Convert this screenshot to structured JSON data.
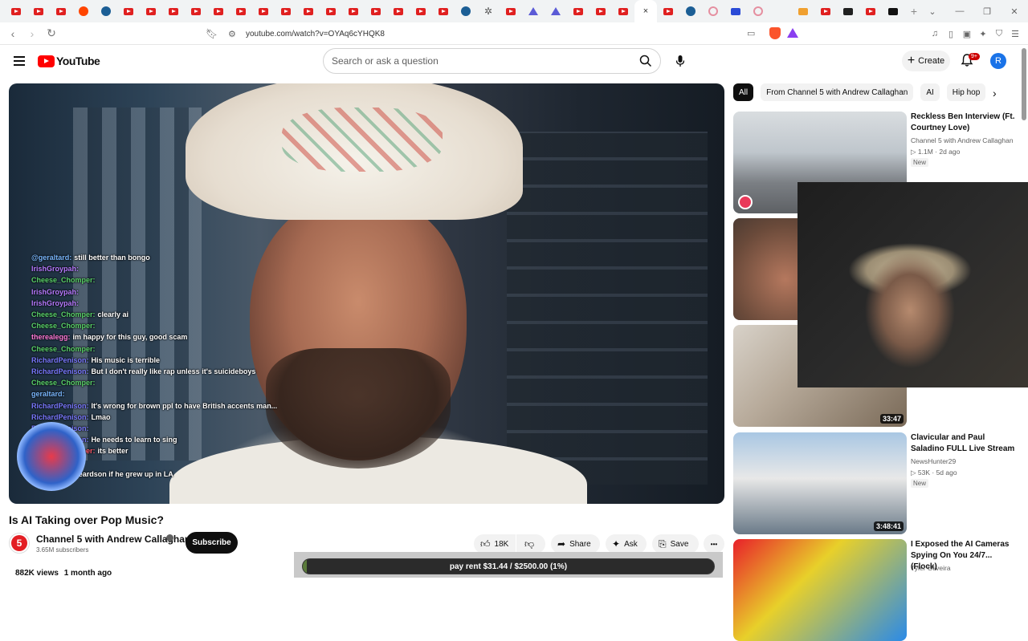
{
  "browser": {
    "active_tab_close": "×",
    "new_tab": "+",
    "url": "youtube.com/watch?v=OYAq6cYHQK8"
  },
  "header": {
    "logo_text": "YouTube",
    "search_placeholder": "Search or ask a question",
    "create_label": "Create",
    "notifications_badge": "9+",
    "avatar_letter": "R"
  },
  "player": {
    "chat": [
      {
        "user": "@geraltard:",
        "msg": "still better than bongo",
        "color": "#7ab8ff"
      },
      {
        "user": "IrishGroypah:",
        "msg": "",
        "color": "#b77bff"
      },
      {
        "user": "Cheese_Chomper:",
        "msg": "",
        "color": "#5ad16a"
      },
      {
        "user": "IrishGroypah:",
        "msg": "",
        "color": "#b77bff"
      },
      {
        "user": "IrishGroypah:",
        "msg": "",
        "color": "#b77bff"
      },
      {
        "user": "Cheese_Chomper:",
        "msg": "clearly ai",
        "color": "#5ad16a"
      },
      {
        "user": "Cheese_Chomper:",
        "msg": "",
        "color": "#5ad16a"
      },
      {
        "user": "therealegg:",
        "msg": "im happy for this guy, good scam",
        "color": "#ff7ad9"
      },
      {
        "user": "Cheese_Chomper:",
        "msg": "",
        "color": "#5ad16a"
      },
      {
        "user": "RichardPenison:",
        "msg": "His music is terrible",
        "color": "#7a7aff"
      },
      {
        "user": "RichardPenison:",
        "msg": "But I don't really like rap unless it's suicideboys",
        "color": "#7a7aff"
      },
      {
        "user": "Cheese_Chomper:",
        "msg": "",
        "color": "#5ad16a"
      },
      {
        "user": "geraltard:",
        "msg": "",
        "color": "#7ab8ff"
      },
      {
        "user": "RichardPenison:",
        "msg": "It's wrong for brown ppl to have British accents man...",
        "color": "#7a7aff"
      },
      {
        "user": "RichardPenison:",
        "msg": "Lmao",
        "color": "#7a7aff"
      },
      {
        "user": "RichardPenison:",
        "msg": "",
        "color": "#7a7aff"
      },
      {
        "user": "RichardPenison:",
        "msg": "He needs to learn to sing",
        "color": "#7a7aff"
      },
      {
        "user": "Cheese_Chomper:",
        "msg": "its better",
        "color": "#ff5a6a"
      },
      {
        "user": "enpaks:",
        "msg": "",
        "color": "#ffffff"
      },
      {
        "user": "@geraltard:",
        "msg": "beardson if he grew up in LA",
        "color": "#7ab8ff"
      }
    ]
  },
  "video": {
    "title": "Is AI Taking over Pop Music?",
    "channel_name": "Channel 5 with Andrew Callaghan",
    "channel_logo": "5",
    "subscribers": "3.65M subscribers",
    "subscribe_label": "Subscribe",
    "likes": "18K",
    "share_label": "Share",
    "ask_label": "Ask",
    "save_label": "Save",
    "more_label": "•••",
    "views": "882K views",
    "uploaded": "1 month ago"
  },
  "donation": {
    "text": "pay rent $31.44 / $2500.00 (1%)",
    "progress_percent": 1
  },
  "chips": [
    "All",
    "From Channel 5 with Andrew Callaghan",
    "AI",
    "Hip hop"
  ],
  "recommendations": [
    {
      "title": "Reckless Ben Interview (Ft. Courtney Love)",
      "channel": "Channel 5 with Andrew Callaghan",
      "meta": "▷ 1.1M · 2d ago",
      "badge": "New",
      "duration": ""
    },
    {
      "title": "",
      "channel": "",
      "meta": "",
      "badge": "",
      "duration": ""
    },
    {
      "title": "",
      "channel": "",
      "meta": "",
      "badge": "",
      "duration": "33:47"
    },
    {
      "title": "Clavicular and Paul Saladino FULL Live Stream",
      "channel": "NewsHunter29",
      "meta": "▷ 53K · 5d ago",
      "badge": "New",
      "duration": "3:48:41"
    },
    {
      "title": "I Exposed the AI Cameras Spying On You 24/7... (Flock)",
      "channel": "Tyler Oliveira",
      "meta": "",
      "badge": "",
      "duration": ""
    }
  ],
  "colors": {
    "youtube_red": "#ff0000",
    "subscribe_bg": "#0f0f0f",
    "chip_active": "#0f0f0f",
    "notif_badge": "#cc0000"
  }
}
